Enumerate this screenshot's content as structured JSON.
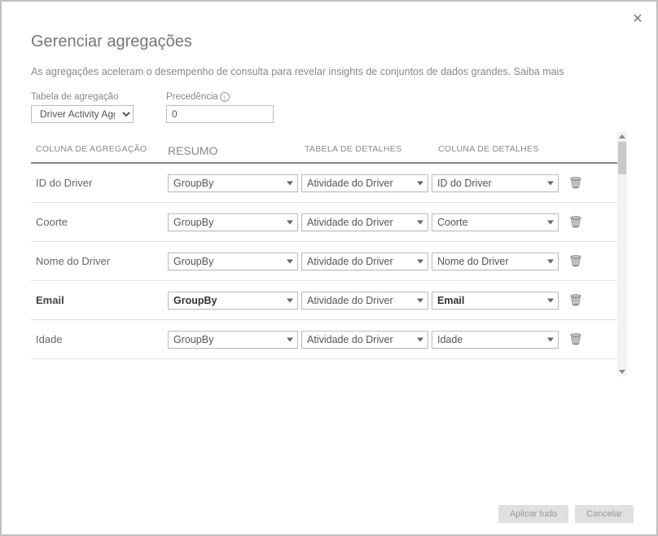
{
  "title": "Gerenciar agregações",
  "subtitle_prefix": "As agregações aceleram o desempenho de consulta para revelar insights de conjuntos de dados grandes. ",
  "learn_more": "Saiba mais",
  "fields": {
    "agg_table_label": "Tabela de agregação",
    "agg_table_value": "Driver Activity Agg",
    "precedence_label": "Precedência",
    "precedence_value": "0"
  },
  "headers": {
    "agg_col": "COLUNA DE AGREGAÇÃO",
    "summary": "RESUMO",
    "detail_table": "TABELA DE DETALHES",
    "detail_col": "COLUNA DE DETALHES"
  },
  "rows": [
    {
      "name": "ID do Driver",
      "summary": "GroupBy",
      "detail_table": "Atividade do Driver",
      "detail_col": "ID do Driver",
      "bold": false
    },
    {
      "name": "Coorte",
      "summary": "GroupBy",
      "detail_table": "Atividade do Driver",
      "detail_col": "Coorte",
      "bold": false
    },
    {
      "name": "Nome do Driver",
      "summary": "GroupBy",
      "detail_table": "Atividade do Driver",
      "detail_col": "Nome do Driver",
      "bold": false
    },
    {
      "name": "Email",
      "summary": "GroupBy",
      "detail_table": "Atividade do Driver",
      "detail_col": "Email",
      "bold": true
    },
    {
      "name": "Idade",
      "summary": "GroupBy",
      "detail_table": "Atividade do Driver",
      "detail_col": "Idade",
      "bold": false
    }
  ],
  "footer": {
    "apply": "Aplicar tudo",
    "cancel": "Cancelar"
  }
}
